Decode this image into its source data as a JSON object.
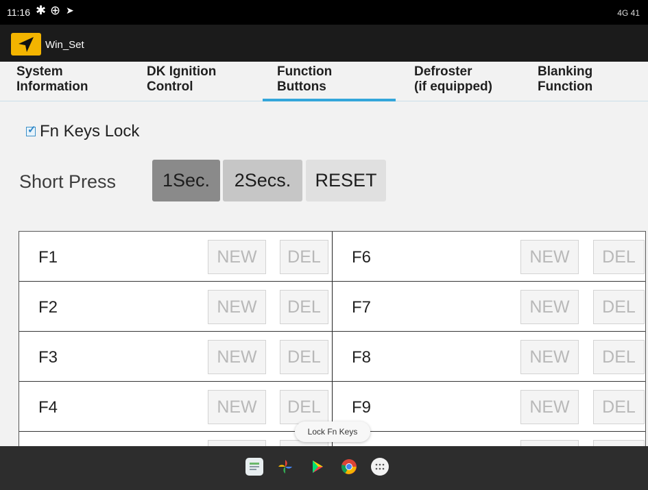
{
  "status_bar": {
    "time": "11:16",
    "right_text": "4G 41",
    "icons": [
      "gear-icon",
      "crosshair-icon",
      "location-arrow-icon"
    ]
  },
  "app_bar": {
    "title": "Win_Set",
    "icon": "navigation-arrow-icon",
    "icon_color": "#f3b400"
  },
  "tabs": [
    {
      "line1": "System",
      "line2": "Information",
      "active": false
    },
    {
      "line1": "DK Ignition",
      "line2": "Control",
      "active": false
    },
    {
      "line1": "Function",
      "line2": "Buttons",
      "active": true
    },
    {
      "line1": "Defroster",
      "line2": "(if equipped)",
      "active": false
    },
    {
      "line1": "Blanking",
      "line2": "Function",
      "active": false
    }
  ],
  "colors": {
    "accent": "#33a6da",
    "selected_button": "#8a8a8a",
    "background": "#f2f2f2"
  },
  "fn_keys_lock": {
    "label": "Fn Keys Lock",
    "checked": true
  },
  "short_press": {
    "label": "Short Press",
    "options": [
      "1Sec.",
      "2Secs."
    ],
    "selected": "1Sec.",
    "reset_label": "RESET"
  },
  "function_keys": {
    "left": [
      "F1",
      "F2",
      "F3",
      "F4"
    ],
    "right": [
      "F6",
      "F7",
      "F8",
      "F9"
    ],
    "new_label": "NEW",
    "del_label": "DEL"
  },
  "toast": "Lock Fn Keys",
  "taskbar": {
    "apps": [
      "files-icon",
      "pinwheel-photos-icon",
      "play-store-icon",
      "chrome-icon",
      "app-drawer-icon"
    ]
  }
}
